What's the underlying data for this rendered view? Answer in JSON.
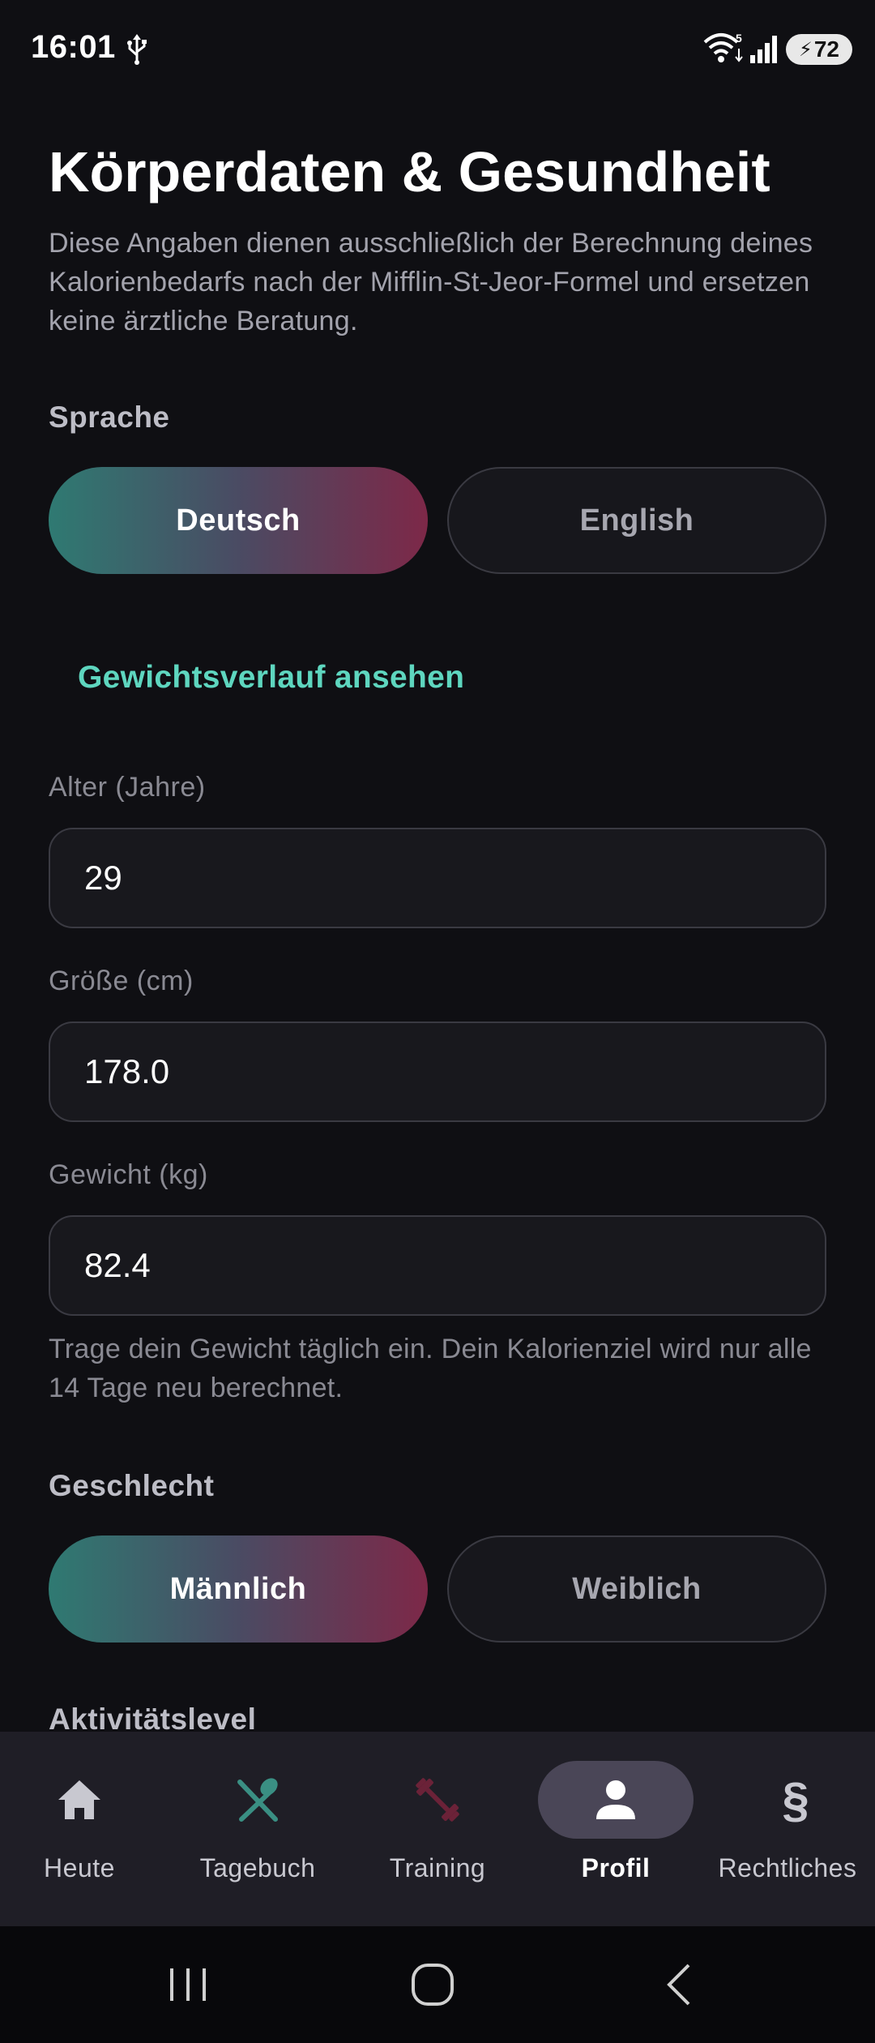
{
  "status_bar": {
    "time": "16:01",
    "battery": "72",
    "icons": [
      "usb-icon",
      "wifi-icon",
      "signal-icon",
      "battery-icon"
    ]
  },
  "page": {
    "title": "Körperdaten & Gesundheit",
    "description": "Diese Angaben dienen ausschließlich der Berechnung deines Kalorienbedarfs nach der Mifflin-St-Jeor-Formel und ersetzen keine ärztliche Beratung."
  },
  "language": {
    "label": "Sprache",
    "options": [
      "Deutsch",
      "English"
    ],
    "selected": "Deutsch"
  },
  "weight_history_link": "Gewichtsverlauf ansehen",
  "fields": {
    "age": {
      "label": "Alter (Jahre)",
      "value": "29"
    },
    "height": {
      "label": "Größe (cm)",
      "value": "178.0"
    },
    "weight": {
      "label": "Gewicht (kg)",
      "value": "82.4"
    }
  },
  "weight_hint": "Trage dein Gewicht täglich ein. Dein Kalorienziel wird nur alle 14 Tage neu berechnet.",
  "gender": {
    "label": "Geschlecht",
    "options": [
      "Männlich",
      "Weiblich"
    ],
    "selected": "Männlich"
  },
  "activity": {
    "label": "Aktivitätslevel"
  },
  "bottom_nav": {
    "items": [
      {
        "label": "Heute",
        "icon": "home-icon"
      },
      {
        "label": "Tagebuch",
        "icon": "cutlery-icon"
      },
      {
        "label": "Training",
        "icon": "dumbbell-icon"
      },
      {
        "label": "Profil",
        "icon": "person-icon"
      },
      {
        "label": "Rechtliches",
        "icon": "section-sign-icon",
        "glyph": "§"
      }
    ],
    "active": "Profil"
  },
  "colors": {
    "background": "#0f0f13",
    "accent_teal": "#5ed6bf",
    "gradient_start": "#2f7a72",
    "gradient_end": "#7d2848",
    "nav_background": "#1f1e26",
    "nav_active_pill": "#4a4657",
    "training_icon": "#6b2238",
    "diary_icon": "#3a8f83"
  }
}
